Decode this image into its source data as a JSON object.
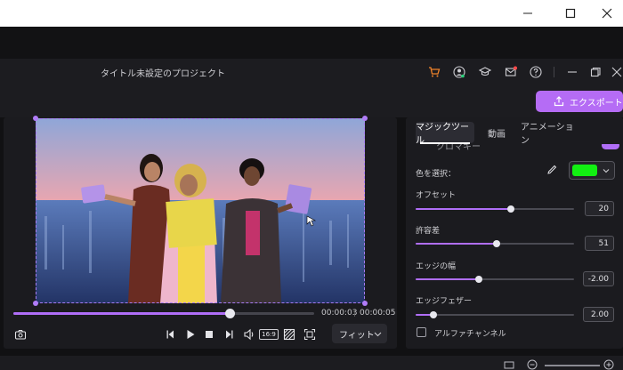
{
  "window": {
    "buttons": [
      "minimize-icon",
      "maximize-icon",
      "close-icon"
    ]
  },
  "header": {
    "project_title": "タイトル未設定のプロジェクト",
    "icons": [
      "cart-icon",
      "account-icon",
      "graduation-cap-icon",
      "mail-icon",
      "help-icon",
      "minimize-icon",
      "restore-icon",
      "close-icon"
    ],
    "accent_cart": "#f0832a",
    "mail_badge": "#ff4a4a"
  },
  "toolbar": {
    "export_label": "エクスポート",
    "export_color": "#b56cf5"
  },
  "player": {
    "progress_fraction": 0.72,
    "current_time": "00:00:03",
    "total_time": "00:00:05",
    "separator": "|",
    "controls": [
      "snapshot-icon",
      "prev-frame-icon",
      "play-icon",
      "stop-icon",
      "next-frame-icon",
      "volume-icon",
      "aspect-ratio-icon",
      "mask-icon",
      "fullscreen-icon"
    ],
    "aspect_ratio_label": "16:9",
    "fit_label": "フィット"
  },
  "panel": {
    "tabs": [
      {
        "label": "マジックツール",
        "active": true
      },
      {
        "label": "動画",
        "active": false
      },
      {
        "label": "アニメーション",
        "active": false
      }
    ],
    "cut_row_text": "クロマキー",
    "color_select_label": "色を選択：",
    "selected_color": "#12f012",
    "sliders": [
      {
        "label": "オフセット",
        "fraction": 0.6,
        "value": "20"
      },
      {
        "label": "許容差",
        "fraction": 0.51,
        "value": "51"
      },
      {
        "label": "エッジの幅",
        "fraction": 0.4,
        "value": "-2.00"
      },
      {
        "label": "エッジフェザー",
        "fraction": 0.11,
        "value": "2.00"
      }
    ],
    "alpha_channel_label": "アルファチャンネル",
    "alpha_channel_checked": false
  }
}
